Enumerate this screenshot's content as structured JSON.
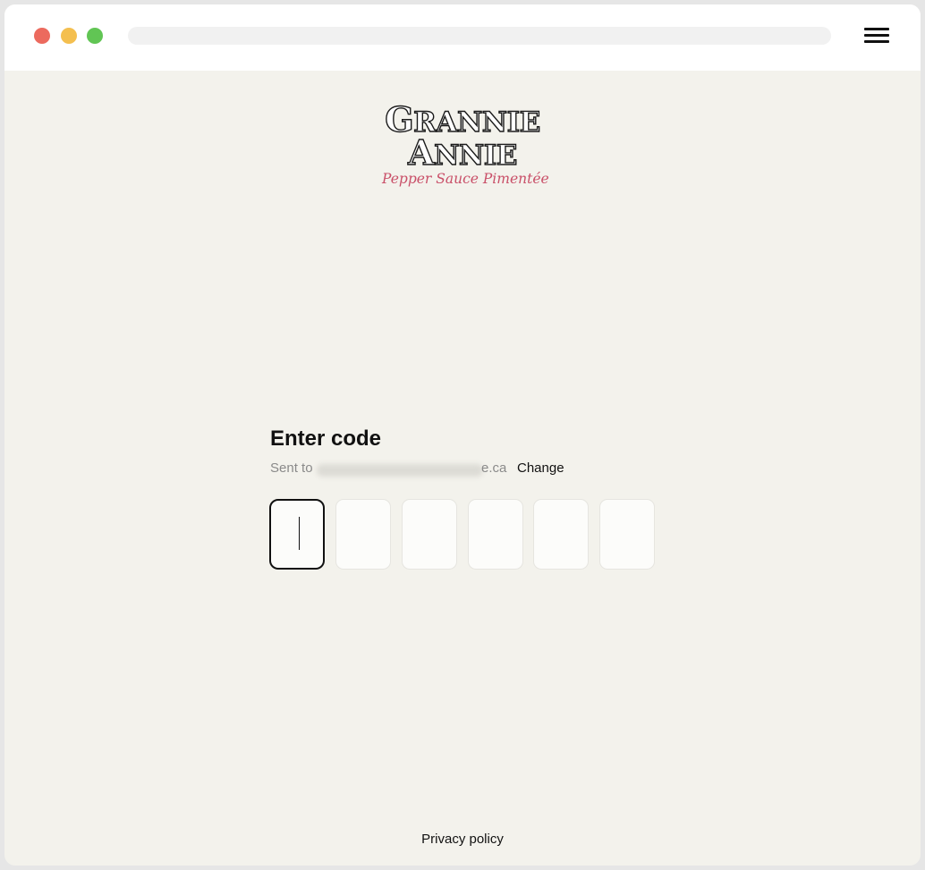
{
  "browser": {
    "window_controls": [
      "close",
      "minimize",
      "maximize"
    ],
    "menu_icon": "hamburger-menu-icon"
  },
  "logo": {
    "line1_first": "G",
    "line1_rest": "RANNIE",
    "line2_first": "A",
    "line2_rest": "NNIE",
    "tagline": "Pepper Sauce Pimentée",
    "tagline_color": "#c94f68"
  },
  "verify": {
    "title": "Enter code",
    "sent_label": "Sent to",
    "email_suffix": "e.ca",
    "change_label": "Change",
    "code_digits": [
      "",
      "",
      "",
      "",
      "",
      ""
    ]
  },
  "footer": {
    "privacy_label": "Privacy policy"
  }
}
